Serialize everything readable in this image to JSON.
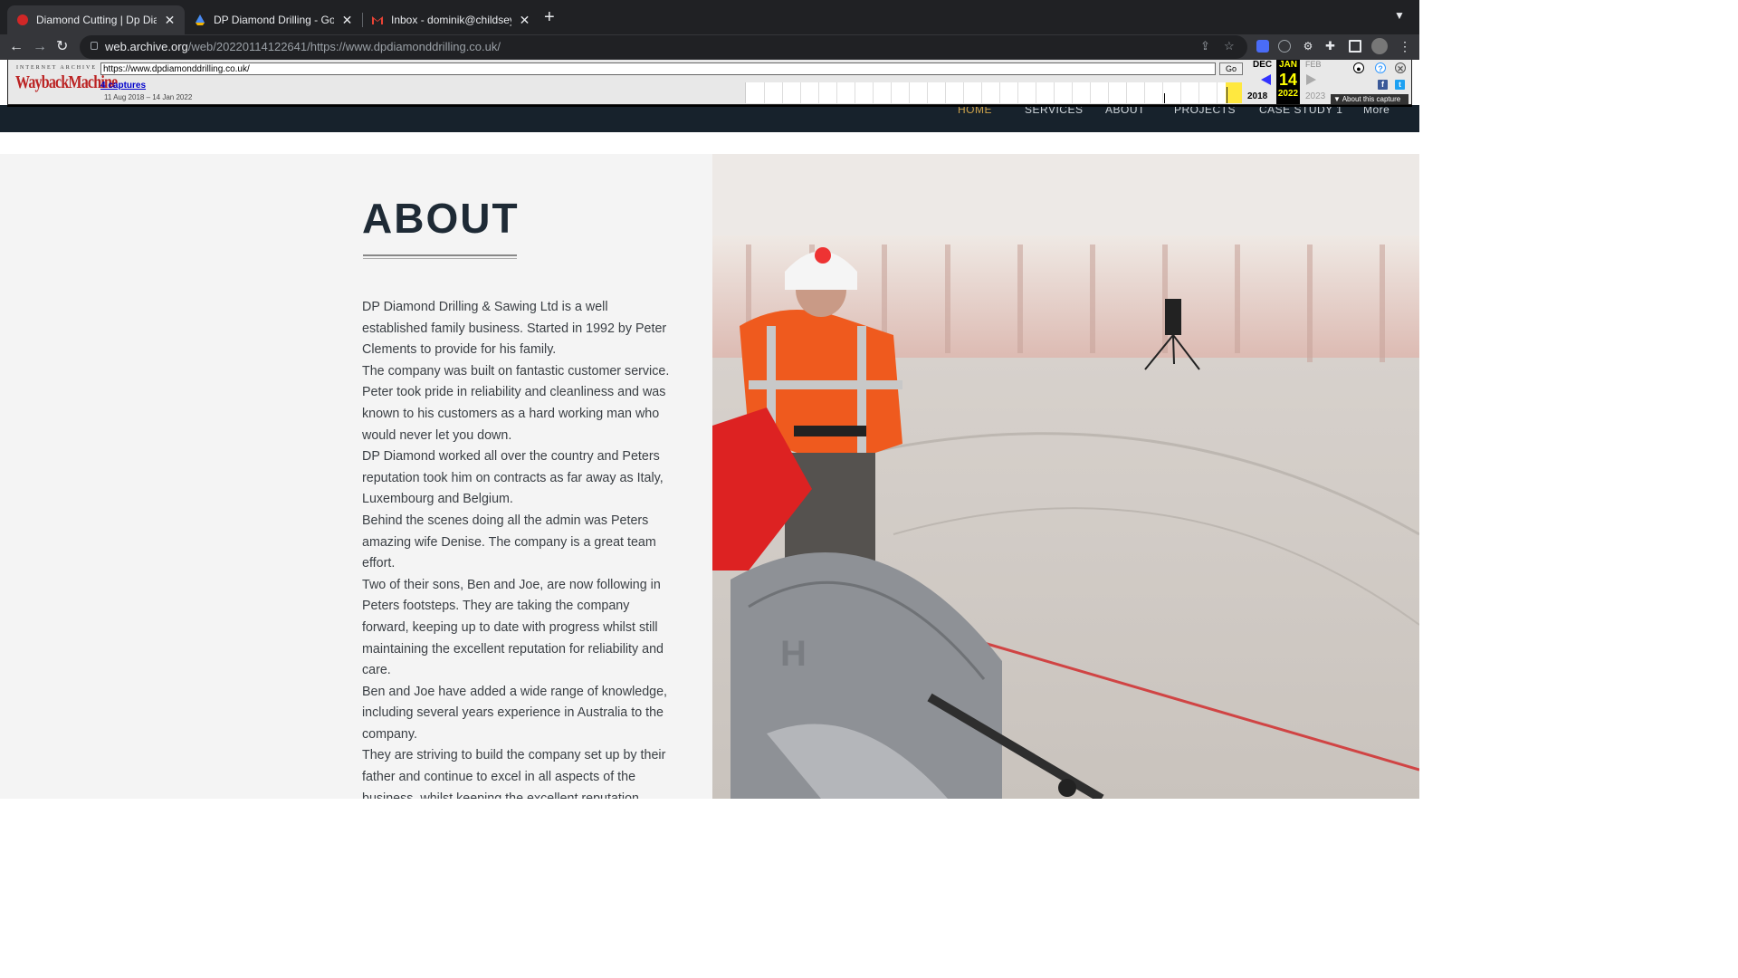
{
  "browser": {
    "tabs": [
      {
        "title": "Diamond Cutting | Dp Diamond Drilling",
        "active": true
      },
      {
        "title": "DP Diamond Drilling - Google Drive",
        "active": false
      },
      {
        "title": "Inbox - dominik@childsey.com",
        "active": false
      }
    ],
    "new_tab": "+",
    "url_host": "web.archive.org",
    "url_path": "/web/20220114122641/https://www.dpdiamonddrilling.co.uk/"
  },
  "wayback": {
    "brand_top": "INTERNET ARCHIVE",
    "brand": "WaybackMachine",
    "input_value": "https://www.dpdiamonddrilling.co.uk/",
    "go_label": "Go",
    "captures": "4 captures",
    "date_range": "11 Aug 2018 – 14 Jan 2022",
    "prev_month": "DEC",
    "cur_month": "JAN",
    "next_month": "FEB",
    "cur_day": "14",
    "prev_year": "2018",
    "cur_year": "2022",
    "next_year": "2023",
    "about_capture": "About this capture"
  },
  "site_nav": [
    "HOME",
    "SERVICES",
    "ABOUT",
    "PROJECTS",
    "CASE STUDY 1",
    "More"
  ],
  "about": {
    "heading": "ABOUT",
    "paragraphs": [
      "DP Diamond Drilling & Sawing Ltd is a well established family business. Started in 1992 by Peter Clements to provide for his family.",
      "The company was built on fantastic customer service. Peter took pride in reliability and cleanliness and was known to his customers as a hard working man who would never let you down.",
      "DP Diamond worked all over the country and Peters reputation took him on contracts  as far away as Italy, Luxembourg and Belgium.",
      "Behind the scenes doing all the admin was Peters amazing wife Denise. The company is a great team effort.",
      "Two of their sons, Ben and Joe, are now following in Peters footsteps. They are taking the company forward, keeping up to date with progress whilst still maintaining the excellent reputation for reliability and care.",
      "Ben and Joe have added a wide range of knowledge, including several years experience in Australia to the company.",
      "They are striving to build the company set up by their father and continue to excel in all aspects of the business, whilst keeping the excellent reputation"
    ]
  }
}
